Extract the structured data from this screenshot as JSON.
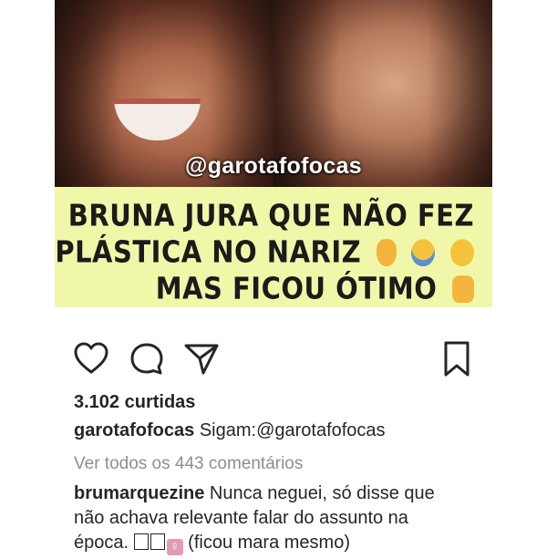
{
  "post": {
    "image": {
      "overlay_handle": "@garotafofocas",
      "headline": {
        "line1": "BRUNA JURA QUE NÃO FEZ",
        "line2": "PLÁSTICA NO NARIZ",
        "line3": "MAS FICOU ÓTIMO"
      },
      "emojis_line2": [
        "nose-emoji",
        "screaming-face-emoji",
        "woozy-face-emoji"
      ],
      "emojis_line3": [
        "thumbs-up-emoji"
      ]
    },
    "actions": {
      "icons": [
        "heart-icon",
        "comment-icon",
        "share-icon",
        "bookmark-icon"
      ]
    },
    "likes_text": "3.102 curtidas",
    "caption": {
      "username": "garotafofocas",
      "text": "Sigam:",
      "mention": "@garotafofocas"
    },
    "view_comments_text": "Ver todos os 443 comentários",
    "top_comment": {
      "username": "brumarquezine",
      "text": "Nunca neguei, só disse que não achava relevante falar do assunto na época. ",
      "trailing": " (ficou mara mesmo)"
    }
  }
}
